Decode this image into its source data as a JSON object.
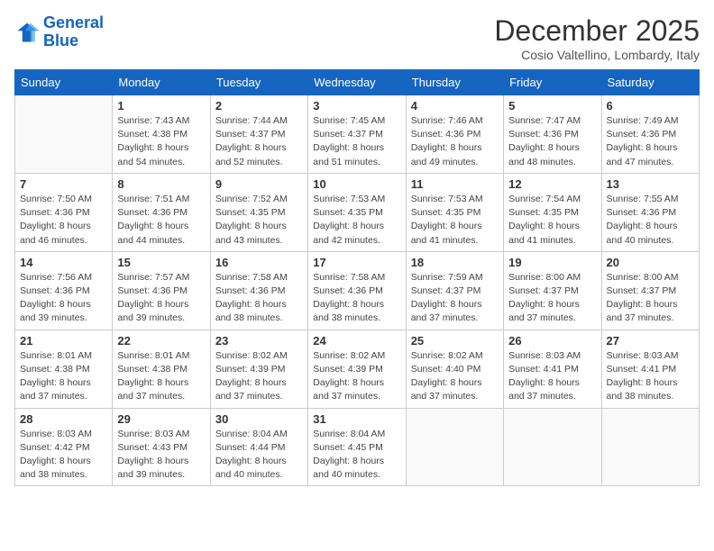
{
  "header": {
    "logo_line1": "General",
    "logo_line2": "Blue",
    "month_title": "December 2025",
    "subtitle": "Cosio Valtellino, Lombardy, Italy"
  },
  "days_of_week": [
    "Sunday",
    "Monday",
    "Tuesday",
    "Wednesday",
    "Thursday",
    "Friday",
    "Saturday"
  ],
  "weeks": [
    [
      {
        "day": "",
        "sunrise": "",
        "sunset": "",
        "daylight": ""
      },
      {
        "day": "1",
        "sunrise": "Sunrise: 7:43 AM",
        "sunset": "Sunset: 4:38 PM",
        "daylight": "Daylight: 8 hours and 54 minutes."
      },
      {
        "day": "2",
        "sunrise": "Sunrise: 7:44 AM",
        "sunset": "Sunset: 4:37 PM",
        "daylight": "Daylight: 8 hours and 52 minutes."
      },
      {
        "day": "3",
        "sunrise": "Sunrise: 7:45 AM",
        "sunset": "Sunset: 4:37 PM",
        "daylight": "Daylight: 8 hours and 51 minutes."
      },
      {
        "day": "4",
        "sunrise": "Sunrise: 7:46 AM",
        "sunset": "Sunset: 4:36 PM",
        "daylight": "Daylight: 8 hours and 49 minutes."
      },
      {
        "day": "5",
        "sunrise": "Sunrise: 7:47 AM",
        "sunset": "Sunset: 4:36 PM",
        "daylight": "Daylight: 8 hours and 48 minutes."
      },
      {
        "day": "6",
        "sunrise": "Sunrise: 7:49 AM",
        "sunset": "Sunset: 4:36 PM",
        "daylight": "Daylight: 8 hours and 47 minutes."
      }
    ],
    [
      {
        "day": "7",
        "sunrise": "Sunrise: 7:50 AM",
        "sunset": "Sunset: 4:36 PM",
        "daylight": "Daylight: 8 hours and 46 minutes."
      },
      {
        "day": "8",
        "sunrise": "Sunrise: 7:51 AM",
        "sunset": "Sunset: 4:36 PM",
        "daylight": "Daylight: 8 hours and 44 minutes."
      },
      {
        "day": "9",
        "sunrise": "Sunrise: 7:52 AM",
        "sunset": "Sunset: 4:35 PM",
        "daylight": "Daylight: 8 hours and 43 minutes."
      },
      {
        "day": "10",
        "sunrise": "Sunrise: 7:53 AM",
        "sunset": "Sunset: 4:35 PM",
        "daylight": "Daylight: 8 hours and 42 minutes."
      },
      {
        "day": "11",
        "sunrise": "Sunrise: 7:53 AM",
        "sunset": "Sunset: 4:35 PM",
        "daylight": "Daylight: 8 hours and 41 minutes."
      },
      {
        "day": "12",
        "sunrise": "Sunrise: 7:54 AM",
        "sunset": "Sunset: 4:35 PM",
        "daylight": "Daylight: 8 hours and 41 minutes."
      },
      {
        "day": "13",
        "sunrise": "Sunrise: 7:55 AM",
        "sunset": "Sunset: 4:36 PM",
        "daylight": "Daylight: 8 hours and 40 minutes."
      }
    ],
    [
      {
        "day": "14",
        "sunrise": "Sunrise: 7:56 AM",
        "sunset": "Sunset: 4:36 PM",
        "daylight": "Daylight: 8 hours and 39 minutes."
      },
      {
        "day": "15",
        "sunrise": "Sunrise: 7:57 AM",
        "sunset": "Sunset: 4:36 PM",
        "daylight": "Daylight: 8 hours and 39 minutes."
      },
      {
        "day": "16",
        "sunrise": "Sunrise: 7:58 AM",
        "sunset": "Sunset: 4:36 PM",
        "daylight": "Daylight: 8 hours and 38 minutes."
      },
      {
        "day": "17",
        "sunrise": "Sunrise: 7:58 AM",
        "sunset": "Sunset: 4:36 PM",
        "daylight": "Daylight: 8 hours and 38 minutes."
      },
      {
        "day": "18",
        "sunrise": "Sunrise: 7:59 AM",
        "sunset": "Sunset: 4:37 PM",
        "daylight": "Daylight: 8 hours and 37 minutes."
      },
      {
        "day": "19",
        "sunrise": "Sunrise: 8:00 AM",
        "sunset": "Sunset: 4:37 PM",
        "daylight": "Daylight: 8 hours and 37 minutes."
      },
      {
        "day": "20",
        "sunrise": "Sunrise: 8:00 AM",
        "sunset": "Sunset: 4:37 PM",
        "daylight": "Daylight: 8 hours and 37 minutes."
      }
    ],
    [
      {
        "day": "21",
        "sunrise": "Sunrise: 8:01 AM",
        "sunset": "Sunset: 4:38 PM",
        "daylight": "Daylight: 8 hours and 37 minutes."
      },
      {
        "day": "22",
        "sunrise": "Sunrise: 8:01 AM",
        "sunset": "Sunset: 4:38 PM",
        "daylight": "Daylight: 8 hours and 37 minutes."
      },
      {
        "day": "23",
        "sunrise": "Sunrise: 8:02 AM",
        "sunset": "Sunset: 4:39 PM",
        "daylight": "Daylight: 8 hours and 37 minutes."
      },
      {
        "day": "24",
        "sunrise": "Sunrise: 8:02 AM",
        "sunset": "Sunset: 4:39 PM",
        "daylight": "Daylight: 8 hours and 37 minutes."
      },
      {
        "day": "25",
        "sunrise": "Sunrise: 8:02 AM",
        "sunset": "Sunset: 4:40 PM",
        "daylight": "Daylight: 8 hours and 37 minutes."
      },
      {
        "day": "26",
        "sunrise": "Sunrise: 8:03 AM",
        "sunset": "Sunset: 4:41 PM",
        "daylight": "Daylight: 8 hours and 37 minutes."
      },
      {
        "day": "27",
        "sunrise": "Sunrise: 8:03 AM",
        "sunset": "Sunset: 4:41 PM",
        "daylight": "Daylight: 8 hours and 38 minutes."
      }
    ],
    [
      {
        "day": "28",
        "sunrise": "Sunrise: 8:03 AM",
        "sunset": "Sunset: 4:42 PM",
        "daylight": "Daylight: 8 hours and 38 minutes."
      },
      {
        "day": "29",
        "sunrise": "Sunrise: 8:03 AM",
        "sunset": "Sunset: 4:43 PM",
        "daylight": "Daylight: 8 hours and 39 minutes."
      },
      {
        "day": "30",
        "sunrise": "Sunrise: 8:04 AM",
        "sunset": "Sunset: 4:44 PM",
        "daylight": "Daylight: 8 hours and 40 minutes."
      },
      {
        "day": "31",
        "sunrise": "Sunrise: 8:04 AM",
        "sunset": "Sunset: 4:45 PM",
        "daylight": "Daylight: 8 hours and 40 minutes."
      },
      {
        "day": "",
        "sunrise": "",
        "sunset": "",
        "daylight": ""
      },
      {
        "day": "",
        "sunrise": "",
        "sunset": "",
        "daylight": ""
      },
      {
        "day": "",
        "sunrise": "",
        "sunset": "",
        "daylight": ""
      }
    ]
  ]
}
